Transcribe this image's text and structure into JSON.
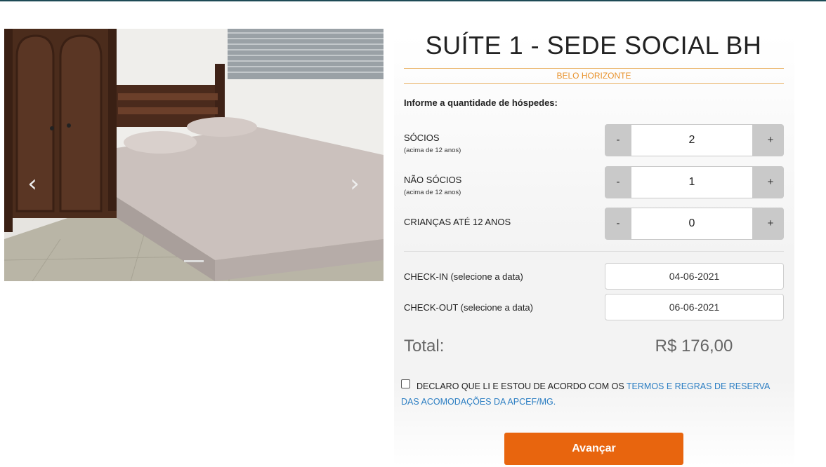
{
  "room": {
    "title": "SUÍTE 1 - SEDE SOCIAL BH",
    "city": "BELO HORIZONTE"
  },
  "carousel": {
    "prev_icon": "chevron-left-icon",
    "next_icon": "chevron-right-icon",
    "prev_glyph": "‹",
    "next_glyph": "›"
  },
  "guests": {
    "instruction": "Informe a quantidade de hóspedes:",
    "minus_label": "-",
    "plus_label": "+",
    "rows": [
      {
        "label": "SÓCIOS",
        "sub": "(acima de 12 anos)",
        "value": "2"
      },
      {
        "label": "NÃO SÓCIOS",
        "sub": "(acima de 12 anos)",
        "value": "1"
      },
      {
        "label": "CRIANÇAS ATÉ 12 ANOS",
        "value": "0"
      }
    ]
  },
  "dates": {
    "checkin_label": "CHECK-IN (selecione a data)",
    "checkin_value": "04-06-2021",
    "checkout_label": "CHECK-OUT (selecione a data)",
    "checkout_value": "06-06-2021"
  },
  "total": {
    "label": "Total:",
    "value": "R$ 176,00"
  },
  "terms": {
    "text": "DECLARO QUE LI E ESTOU DE ACORDO COM OS ",
    "link": "TERMOS E REGRAS DE RESERVA DAS ACOMODAÇÕES DA APCEF/MG."
  },
  "actions": {
    "next_label": "Avançar"
  },
  "colors": {
    "accent_orange": "#e8650e",
    "city_orange": "#e8922c",
    "link_blue": "#2a7dc2",
    "top_bar": "#1d4a55"
  }
}
